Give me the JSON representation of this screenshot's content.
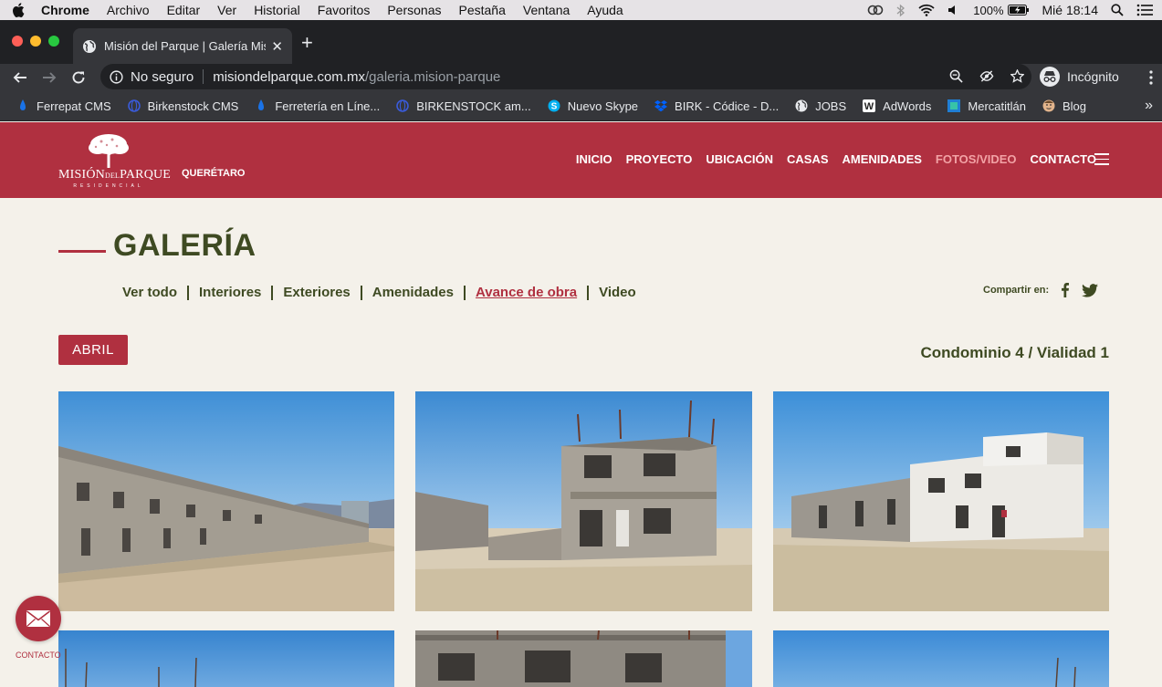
{
  "menubar": {
    "items": [
      "Chrome",
      "Archivo",
      "Editar",
      "Ver",
      "Historial",
      "Favoritos",
      "Personas",
      "Pestaña",
      "Ventana",
      "Ayuda"
    ],
    "battery": "100%",
    "clock": "Mié 18:14"
  },
  "browser": {
    "tab_title": "Misión del Parque | Galería Misi",
    "security_label": "No seguro",
    "url_host": "misiondelparque.com.mx",
    "url_path": "/galeria.mision-parque",
    "profile_label": "Incógnito"
  },
  "bookmarks": [
    {
      "label": "Ferrepat CMS",
      "icon": "drop-icon"
    },
    {
      "label": "Birkenstock CMS",
      "icon": "globe-icon"
    },
    {
      "label": "Ferretería en Líne...",
      "icon": "drop-icon"
    },
    {
      "label": "BIRKENSTOCK am...",
      "icon": "globe-icon"
    },
    {
      "label": "Nuevo Skype",
      "icon": "skype-icon"
    },
    {
      "label": "BIRK - Códice - D...",
      "icon": "dropbox-icon"
    },
    {
      "label": "JOBS",
      "icon": "globe-icon"
    },
    {
      "label": "AdWords",
      "icon": "w-icon"
    },
    {
      "label": "Mercatitlán",
      "icon": "square-icon"
    },
    {
      "label": "Blog",
      "icon": "face-icon"
    }
  ],
  "site": {
    "logo_name_1": "MISIÓN",
    "logo_name_2": "DEL",
    "logo_name_3": "PARQUE",
    "logo_sub": "RESIDENCIAL",
    "city": "QUERÉTARO",
    "nav": [
      "INICIO",
      "PROYECTO",
      "UBICACIÓN",
      "CASAS",
      "AMENIDADES",
      "FOTOS/VIDEO",
      "CONTACTO"
    ],
    "nav_active": "FOTOS/VIDEO",
    "brand_color": "#b03040",
    "text_color": "#3e4a22"
  },
  "gallery": {
    "title": "GALERÍA",
    "filters": [
      "Ver todo",
      "Interiores",
      "Exteriores",
      "Amenidades",
      "Avance de obra",
      "Video"
    ],
    "filter_active": "Avance de obra",
    "share_label": "Compartir en:",
    "month": "ABRIL",
    "section": "Condominio 4 / Vialidad 1"
  },
  "contact_fab": {
    "label": "CONTACTO",
    "icon": "envelope-icon"
  }
}
